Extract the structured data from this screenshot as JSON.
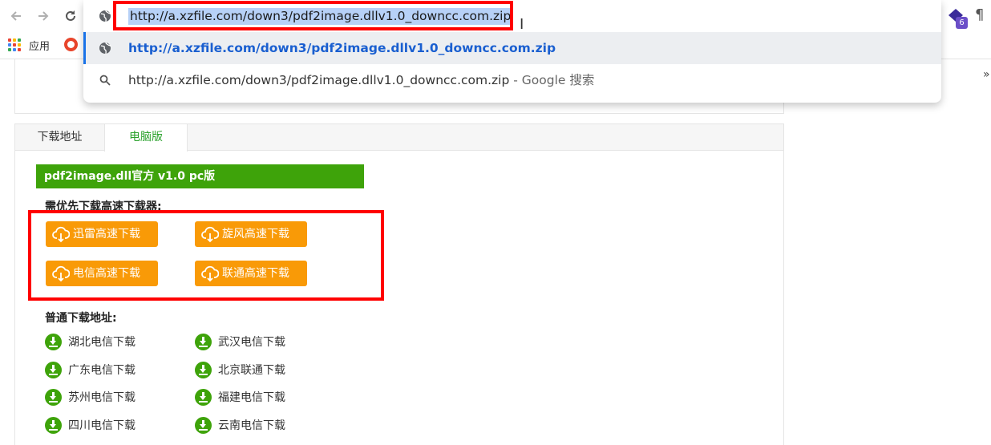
{
  "browser": {
    "url": "http://a.xzfile.com/down3/pdf2image.dllv1.0_downcc.com.zip",
    "suggestions": [
      {
        "text": "http://a.xzfile.com/down3/pdf2image.dllv1.0_downcc.com.zip",
        "suffix": ""
      },
      {
        "text": "http://a.xzfile.com/down3/pdf2image.dllv1.0_downcc.com.zip",
        "suffix": " - Google 搜索"
      }
    ],
    "bookmarks": {
      "apps_label": "应用"
    },
    "extension_badge": "6",
    "extension_para": "¶",
    "overflow": "»"
  },
  "page": {
    "tabs": [
      "下载地址",
      "电脑版"
    ],
    "active_tab": "电脑版",
    "product_title": "pdf2image.dll官方 v1.0 pc版",
    "fast_section_label": "需优先下载高速下载器:",
    "fast_buttons": [
      "迅雷高速下载",
      "旋风高速下载",
      "电信高速下载",
      "联通高速下载"
    ],
    "normal_section_label": "普通下载地址:",
    "normal_links": [
      "湖北电信下载",
      "武汉电信下载",
      "广东电信下载",
      "北京联通下载",
      "苏州电信下载",
      "福建电信下载",
      "四川电信下载",
      "云南电信下载"
    ]
  },
  "colors": {
    "green": "#3ea30a",
    "orange": "#f99a07",
    "highlight_red": "#ff0000",
    "link_blue": "#1a5fd0"
  }
}
